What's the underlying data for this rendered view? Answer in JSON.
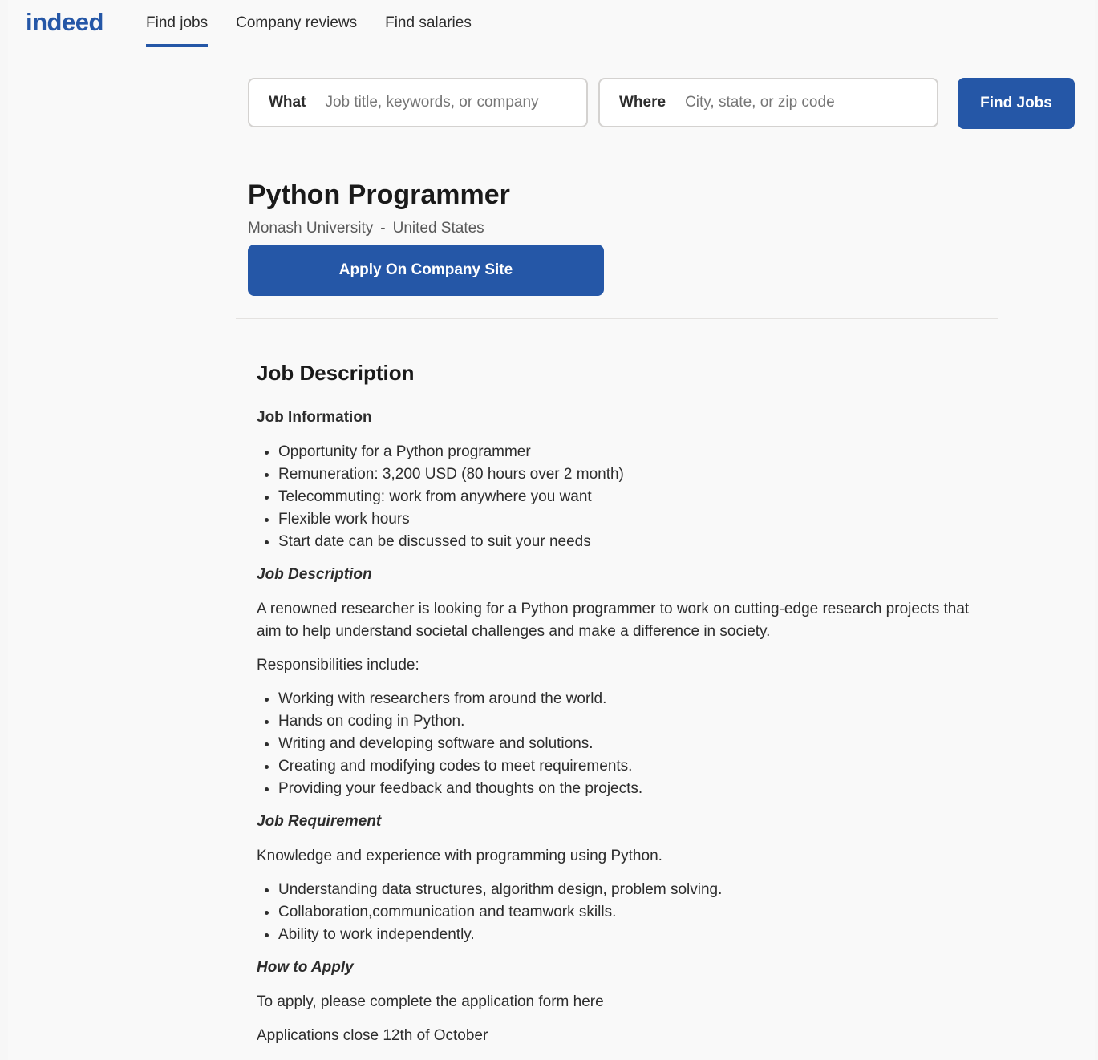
{
  "header": {
    "logo": "indeed",
    "nav": [
      "Find jobs",
      "Company reviews",
      "Find salaries"
    ]
  },
  "search": {
    "what_label": "What",
    "what_placeholder": "Job title, keywords, or company",
    "where_label": "Where",
    "where_placeholder": "City, state, or zip code",
    "button": "Find Jobs"
  },
  "job": {
    "title": "Python Programmer",
    "company": "Monash University",
    "separator": "-",
    "location": "United States",
    "apply_button": "Apply On Company Site"
  },
  "description": {
    "heading": "Job Description",
    "info_heading": "Job Information",
    "info_items": [
      "Opportunity for a Python programmer",
      "Remuneration: 3,200 USD (80 hours over 2 month)",
      "Telecommuting: work from anywhere you want",
      "Flexible work hours",
      "Start date can be discussed to suit your needs"
    ],
    "desc_heading": "Job Description",
    "desc_text": "A renowned researcher is looking for a Python programmer to work on cutting-edge research projects that aim to help understand societal challenges and make a difference in society.",
    "resp_intro": "Responsibilities include:",
    "resp_items": [
      "Working with researchers from around the world.",
      "Hands on coding in Python.",
      "Writing and developing software and solutions.",
      "Creating and modifying codes to meet requirements.",
      "Providing your feedback and thoughts on the projects."
    ],
    "req_heading": "Job Requirement",
    "req_intro": "Knowledge and experience with programming using Python.",
    "req_items": [
      "Understanding data structures, algorithm design, problem solving.",
      "Collaboration,communication and teamwork skills.",
      "Ability to work independently."
    ],
    "apply_heading": "How to Apply",
    "apply_text": "To apply, please complete the application form here",
    "close_text": "Applications close 12th of October"
  },
  "colors": {
    "brand": "#2557a7",
    "text": "#2d2d2d",
    "muted": "#595959"
  }
}
